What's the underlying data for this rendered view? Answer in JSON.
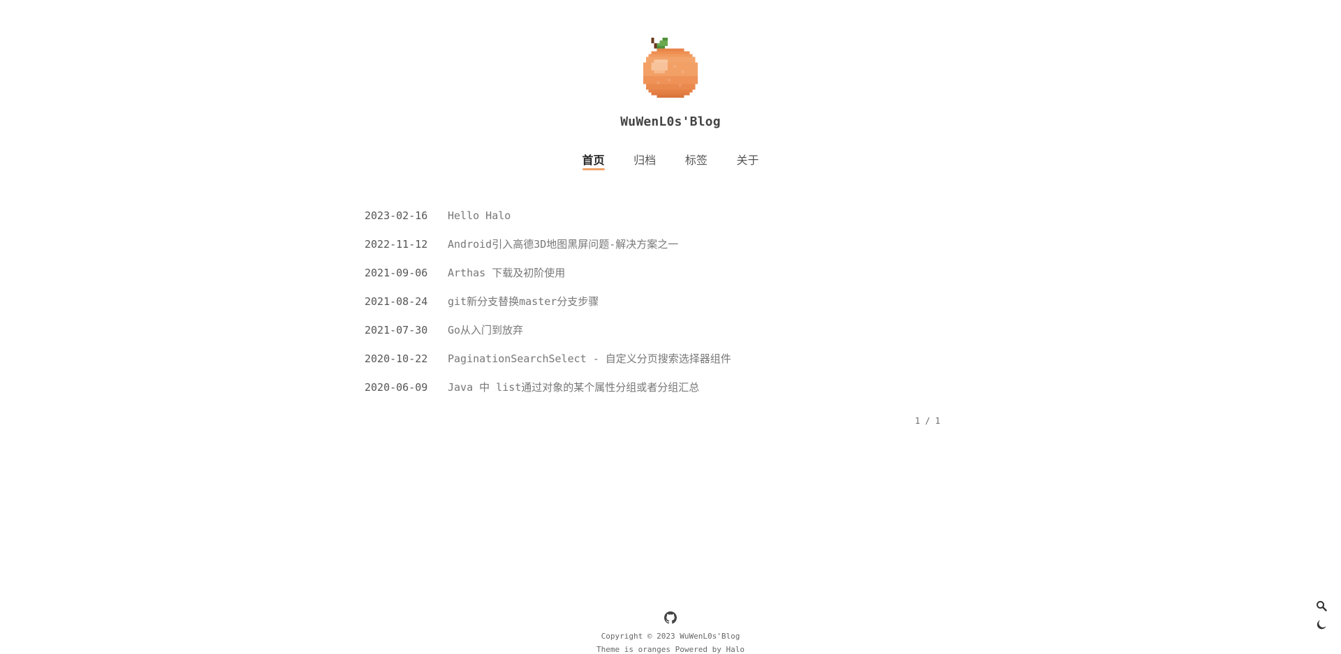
{
  "site": {
    "title": "WuWenL0s'Blog",
    "logo_icon": "orange-pixel-logo"
  },
  "nav": {
    "items": [
      {
        "label": "首页",
        "active": true
      },
      {
        "label": "归档",
        "active": false
      },
      {
        "label": "标签",
        "active": false
      },
      {
        "label": "关于",
        "active": false
      }
    ]
  },
  "posts": [
    {
      "date": "2023-02-16",
      "title": "Hello Halo"
    },
    {
      "date": "2022-11-12",
      "title": "Android引入高德3D地图黑屏问题-解决方案之一"
    },
    {
      "date": "2021-09-06",
      "title": "Arthas 下载及初阶使用"
    },
    {
      "date": "2021-08-24",
      "title": "git新分支替换master分支步骤"
    },
    {
      "date": "2021-07-30",
      "title": "Go从入门到放弃"
    },
    {
      "date": "2020-10-22",
      "title": "PaginationSearchSelect - 自定义分页搜索选择器组件"
    },
    {
      "date": "2020-06-09",
      "title": "Java 中 list通过对象的某个属性分组或者分组汇总"
    }
  ],
  "pagination": {
    "text": "1 / 1"
  },
  "footer": {
    "github_icon": "github-icon",
    "copyright": "Copyright © 2023 WuWenL0s'Blog",
    "theme_line": "Theme is oranges Powered by Halo"
  },
  "tools": {
    "search_icon": "search-icon",
    "theme_icon": "moon-icon"
  },
  "colors": {
    "accent": "#f0a36a",
    "orange": "#f08a4b",
    "leaf": "#6aa84f"
  }
}
